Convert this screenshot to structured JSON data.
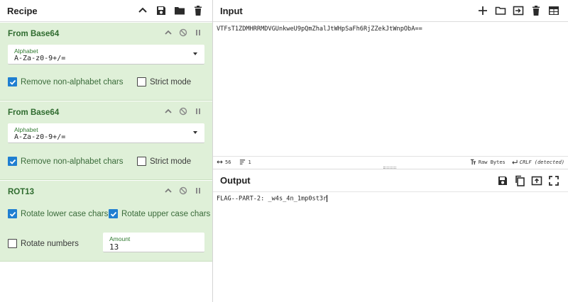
{
  "recipe": {
    "title": "Recipe",
    "icons": [
      "chevron-up-icon",
      "save-icon",
      "folder-icon",
      "trash-icon"
    ],
    "operations": [
      {
        "name": "From Base64",
        "alphabet_label": "Alphabet",
        "alphabet_value": "A-Za-z0-9+/=",
        "checkboxes": [
          {
            "label": "Remove non-alphabet chars",
            "checked": true
          },
          {
            "label": "Strict mode",
            "checked": false
          }
        ]
      },
      {
        "name": "From Base64",
        "alphabet_label": "Alphabet",
        "alphabet_value": "A-Za-z0-9+/=",
        "checkboxes": [
          {
            "label": "Remove non-alphabet chars",
            "checked": true
          },
          {
            "label": "Strict mode",
            "checked": false
          }
        ]
      },
      {
        "name": "ROT13",
        "checkboxes": [
          {
            "label": "Rotate lower case chars",
            "checked": true
          },
          {
            "label": "Rotate upper case chars",
            "checked": true
          },
          {
            "label": "Rotate numbers",
            "checked": false
          }
        ],
        "amount_label": "Amount",
        "amount_value": "13"
      }
    ]
  },
  "input": {
    "title": "Input",
    "text": "VTFsT1ZDMHRRMDVGUnkweU9pQmZhalJtWHpSaFh6RjZZekJtWnpObA==",
    "status": {
      "length": "56",
      "lines": "1",
      "encoding": "Raw Bytes",
      "eol": "CRLF (detected)"
    }
  },
  "output": {
    "title": "Output",
    "text": "FLAG--PART-2: _w4s_4n_1mp0st3r"
  },
  "colors": {
    "op_background": "#dff0d8",
    "op_title": "#2f6b2f",
    "checkbox_checked": "#1f7fd1"
  }
}
